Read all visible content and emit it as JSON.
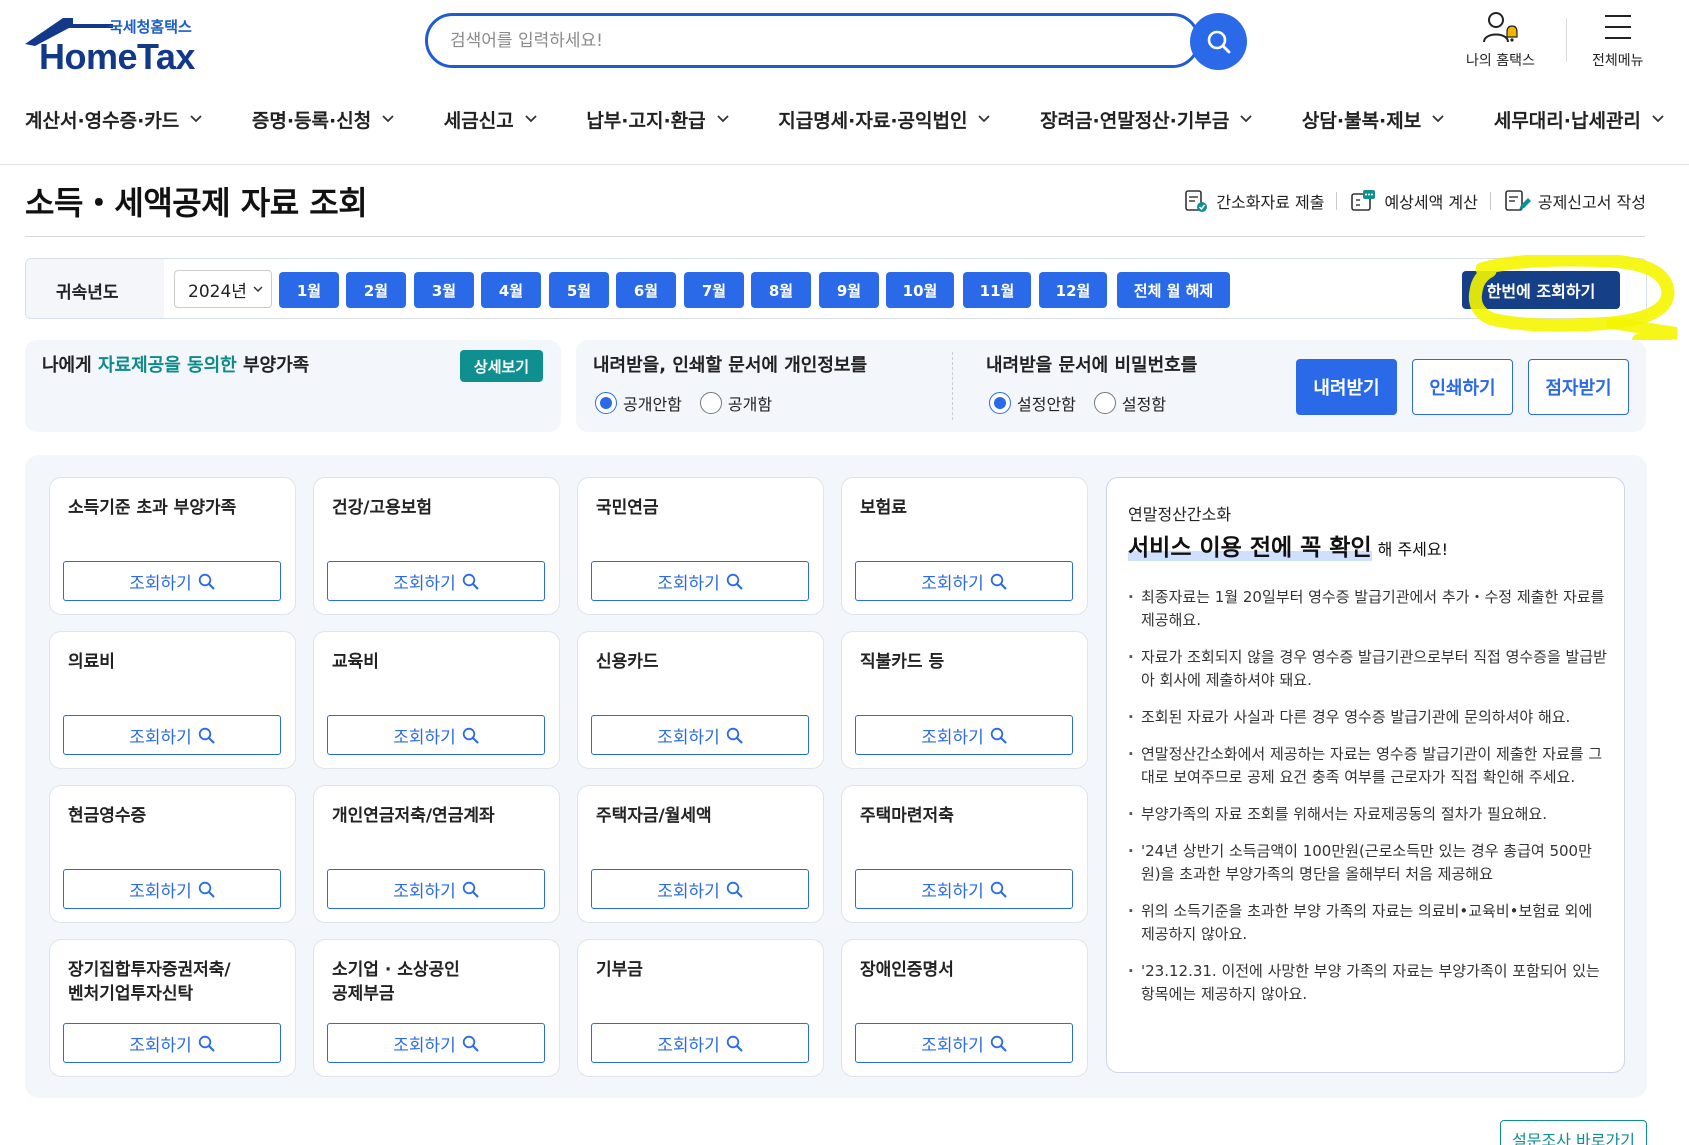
{
  "header": {
    "logo_sub": "국세청홈택스",
    "logo_main": "HomeTax",
    "search_placeholder": "검색어를 입력하세요!",
    "my_hometax": "나의 홈택스",
    "all_menu": "전체메뉴",
    "nav": [
      "계산서·영수증·카드",
      "증명·등록·신청",
      "세금신고",
      "납부·고지·환급",
      "지급명세·자료·공익법인",
      "장려금·연말정산·기부금",
      "상담·불복·제보",
      "세무대리·납세관리"
    ]
  },
  "page": {
    "title": "소득・세액공제 자료 조회",
    "actions": [
      "간소화자료 제출",
      "예상세액 계산",
      "공제신고서 작성"
    ]
  },
  "yearbar": {
    "label": "귀속년도",
    "year": "2024년",
    "months": [
      "1월",
      "2월",
      "3월",
      "4월",
      "5월",
      "6월",
      "7월",
      "8월",
      "9월",
      "10월",
      "11월",
      "12월"
    ],
    "clear_all": "전체 월 해제",
    "query_all": "한번에 조회하기"
  },
  "consent": {
    "text_pre": "나에게 ",
    "text_accent": "자료제공을 동의한",
    "text_post": " 부양가족",
    "detail_btn": "상세보기"
  },
  "privacy": {
    "title": "내려받을, 인쇄할 문서에 개인정보를",
    "options": [
      "공개안함",
      "공개함"
    ],
    "selected": "공개안함"
  },
  "password": {
    "title": "내려받을 문서에 비밀번호를",
    "options": [
      "설정안함",
      "설정함"
    ],
    "selected": "설정안함"
  },
  "actions": {
    "download": "내려받기",
    "print": "인쇄하기",
    "braille": "점자받기"
  },
  "card_button_label": "조회하기",
  "cards": [
    "소득기준 초과 부양가족",
    "건강/고용보험",
    "국민연금",
    "보험료",
    "의료비",
    "교육비",
    "신용카드",
    "직불카드 등",
    "현금영수증",
    "개인연금저축/연금계좌",
    "주택자금/월세액",
    "주택마련저축",
    "장기집합투자증권저축/\n벤처기업투자신탁",
    "소기업 · 소상공인\n공제부금",
    "기부금",
    "장애인증명서"
  ],
  "notice": {
    "kicker": "연말정산간소화",
    "headline": "서비스 이용 전에 꼭 확인",
    "headline_tail": "해 주세요!",
    "items": [
      "최종자료는 1월 20일부터 영수증 발급기관에서 추가・수정 제출한 자료를 제공해요.",
      "자료가 조회되지 않을 경우 영수증 발급기관으로부터 직접 영수증을 발급받아 회사에 제출하셔야 돼요.",
      "조회된 자료가 사실과 다른 경우 영수증 발급기관에 문의하셔야 해요.",
      "연말정산간소화에서 제공하는 자료는 영수증 발급기관이 제출한 자료를 그대로 보여주므로 공제 요건 충족 여부를 근로자가 직접 확인해 주세요.",
      "부양가족의 자료 조회를 위해서는 자료제공동의 절차가 필요해요.",
      "'24년 상반기 소득금액이 100만원(근로소득만 있는 경우 총급여 500만원)을 초과한 부양가족의 명단을 올해부터 처음 제공해요",
      "위의 소득기준을 초과한 부양 가족의 자료는 의료비•교육비•보험료 외에 제공하지 않아요.",
      "'23.12.31. 이전에 사망한 부양 가족의 자료는 부양가족이 포함되어 있는 항목에는 제공하지 않아요."
    ]
  },
  "survey_button": "설문조사 바로가기",
  "colors": {
    "primary": "#2a6ae8",
    "navy": "#153f86",
    "teal": "#0f8f8f",
    "highlight_marker": "#f5f500"
  }
}
